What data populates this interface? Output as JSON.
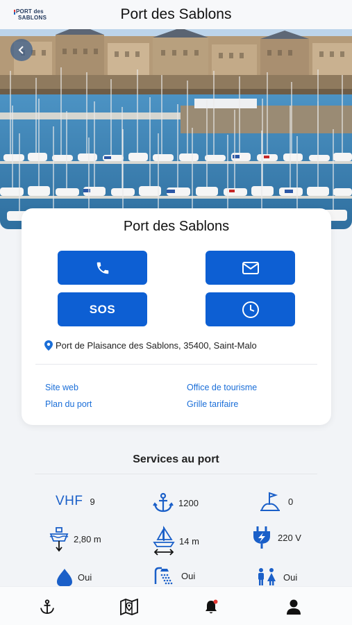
{
  "header": {
    "logo_line1": "PORT des",
    "logo_line2": "SABLONS",
    "title": "Port des Sablons"
  },
  "hero": {
    "back_icon": "chevron-left-icon"
  },
  "card": {
    "title": "Port des Sablons",
    "buttons": {
      "phone_icon": "phone-icon",
      "mail_icon": "mail-icon",
      "sos_label": "SOS",
      "clock_icon": "clock-icon"
    },
    "address": "Port de Plaisance des Sablons, 35400, Saint-Malo",
    "links": {
      "website": "Site web",
      "tourism": "Office de tourisme",
      "port_map": "Plan du port",
      "rates": "Grille tarifaire"
    }
  },
  "services": {
    "title": "Services au port",
    "items": [
      {
        "icon": "vhf-label",
        "label": "VHF",
        "value": "9"
      },
      {
        "icon": "anchor-icon",
        "value": "1200"
      },
      {
        "icon": "visitor-berth-icon",
        "value": "0"
      },
      {
        "icon": "draft-icon",
        "value": "2,80 m"
      },
      {
        "icon": "boat-length-icon",
        "value": "14 m"
      },
      {
        "icon": "electricity-icon",
        "value": "220 V"
      },
      {
        "icon": "water-drop-icon",
        "value": "Oui"
      },
      {
        "icon": "shower-icon",
        "value": "Oui"
      },
      {
        "icon": "toilets-icon",
        "value": "Oui"
      }
    ]
  },
  "tabbar": {
    "tabs": [
      "anchor-icon",
      "map-icon",
      "bell-icon",
      "user-icon"
    ]
  },
  "colors": {
    "primary": "#0d5fd3",
    "link": "#1a6ed8",
    "notification_dot": "#e53935"
  }
}
